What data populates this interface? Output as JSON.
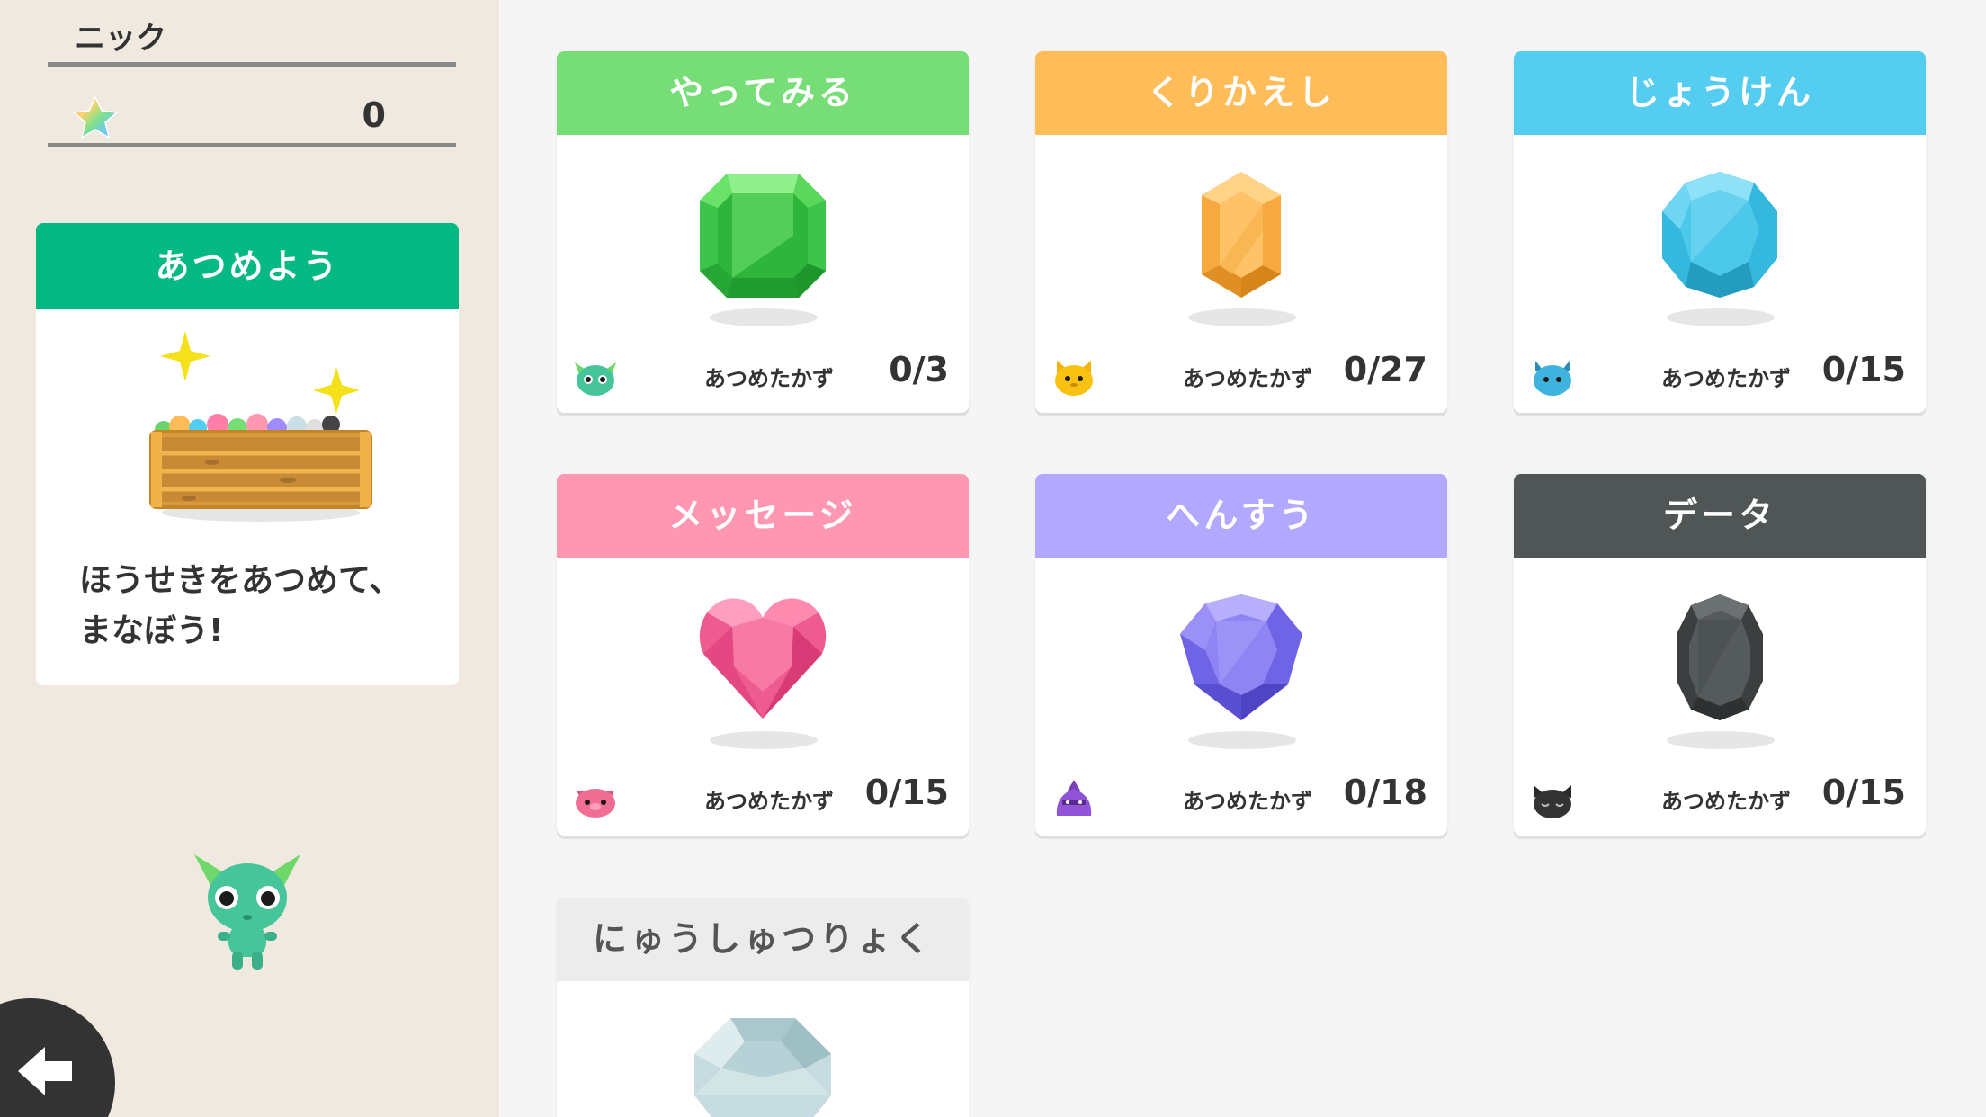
{
  "user": {
    "name": "ニック",
    "points": "0"
  },
  "collect": {
    "title": "あつめよう",
    "message": "ほうせきをあつめて、\nまなぼう!"
  },
  "count_label": "あつめたかず",
  "cards": [
    {
      "title": "やってみる",
      "count": "0/3",
      "color": "#77de77",
      "gem": "green-emerald-gem-icon",
      "character": "green-monster-icon"
    },
    {
      "title": "くりかえし",
      "count": "0/27",
      "color": "#ffbd59",
      "gem": "orange-gem-icon",
      "character": "yellow-cat-icon"
    },
    {
      "title": "じょうけん",
      "count": "0/15",
      "color": "#55cdf1",
      "gem": "blue-round-gem-icon",
      "character": "blue-horned-monster-icon"
    },
    {
      "title": "メッセージ",
      "count": "0/15",
      "color": "#ff97b3",
      "gem": "pink-heart-gem-icon",
      "character": "pink-pig-monster-icon"
    },
    {
      "title": "へんすう",
      "count": "0/18",
      "color": "#b3a8ff",
      "gem": "purple-gem-icon",
      "character": "purple-onion-monster-icon"
    },
    {
      "title": "データ",
      "count": "0/15",
      "color": "#505555",
      "gem": "dark-oval-gem-icon",
      "character": "black-cat-icon"
    },
    {
      "title": "にゅうしゅつりょく",
      "count": "",
      "color": "#ececec",
      "gem": "clear-diamond-gem-icon",
      "character": ""
    }
  ]
}
